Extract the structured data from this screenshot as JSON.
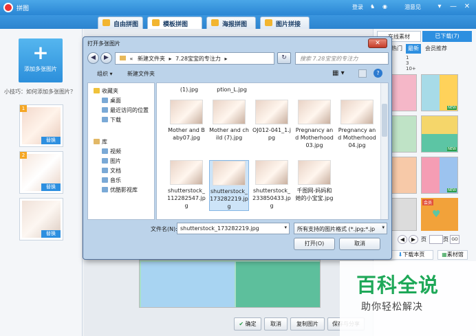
{
  "app": {
    "title": "拼图",
    "login": "登录",
    "tips": "泪意见",
    "window_buttons": [
      "▾",
      "—",
      "✕"
    ]
  },
  "main_tabs": [
    "自由拼图",
    "模板拼图",
    "海报拼图",
    "图片拼接"
  ],
  "left_panel": {
    "add_button_icon": "+",
    "add_button": "添加多张图片",
    "tip": "小技巧：如何添加多张图片？",
    "thumbs": [
      {
        "num": "1",
        "replace": "替换"
      },
      {
        "num": "2",
        "replace": "替换"
      },
      {
        "num": "",
        "replace": "替换"
      }
    ]
  },
  "right_panel": {
    "tabs": [
      "在线素材",
      "已下载(7)"
    ],
    "subtabs": [
      "热门",
      "最新",
      "会员推荐"
    ],
    "counts": [
      "1",
      "3",
      "10+"
    ],
    "new_badge": "NEW",
    "vip_badge": "会员",
    "go_to": "GO",
    "page_label": "页",
    "download_page": "下载本页",
    "material_hall": "素材馆"
  },
  "bottom_buttons": [
    "确定",
    "取消",
    "复制图片",
    "保存与分享"
  ],
  "dialog": {
    "title": "打开多张图片",
    "breadcrumb": [
      "«",
      "新建文件夹",
      "▸",
      "7.28宝宝的专注力",
      "▸"
    ],
    "search_placeholder": "搜索 7.28宝宝的专注力",
    "organize": "组织 ▾",
    "new_folder": "新建文件夹",
    "nav_items": [
      {
        "label": "收藏夹",
        "kind": "star"
      },
      {
        "label": "桌面",
        "kind": "folder"
      },
      {
        "label": "最近访问的位置",
        "kind": "folder"
      },
      {
        "label": "下载",
        "kind": "folder"
      },
      {
        "label": "库",
        "kind": "lib"
      },
      {
        "label": "视频",
        "kind": "folder"
      },
      {
        "label": "图片",
        "kind": "folder"
      },
      {
        "label": "文档",
        "kind": "folder"
      },
      {
        "label": "音乐",
        "kind": "folder"
      },
      {
        "label": "优酷影视库",
        "kind": "folder"
      }
    ],
    "top_partial_files": [
      "(1).jpg",
      "ption_L.jpg"
    ],
    "files_row1": [
      "Mother and Baby07.jpg",
      "Mother and child (7).jpg",
      "OJ012-041_1.jpg",
      "Pregnancy and Motherhood03.jpg",
      "Pregnancy and Motherhood04.jpg"
    ],
    "files_row2": [
      "shutterstock_112282547.jpg",
      "shutterstock_173282219.jpg",
      "shutterstock_233850433.jpg",
      "千图网-妈妈和她的小宝宝.jpg"
    ],
    "filename_label": "文件名(N):",
    "filename_value": "shutterstock_173282219.jpg",
    "filetype": "所有支持的图片格式 (*.jpg;*.jp",
    "open": "打开(O)",
    "cancel": "取消"
  },
  "watermark": {
    "title": "百科全说",
    "subtitle": "助你轻松解决"
  },
  "colors": {
    "accent": "#2c8fdb",
    "brand_green": "#1ea858"
  }
}
